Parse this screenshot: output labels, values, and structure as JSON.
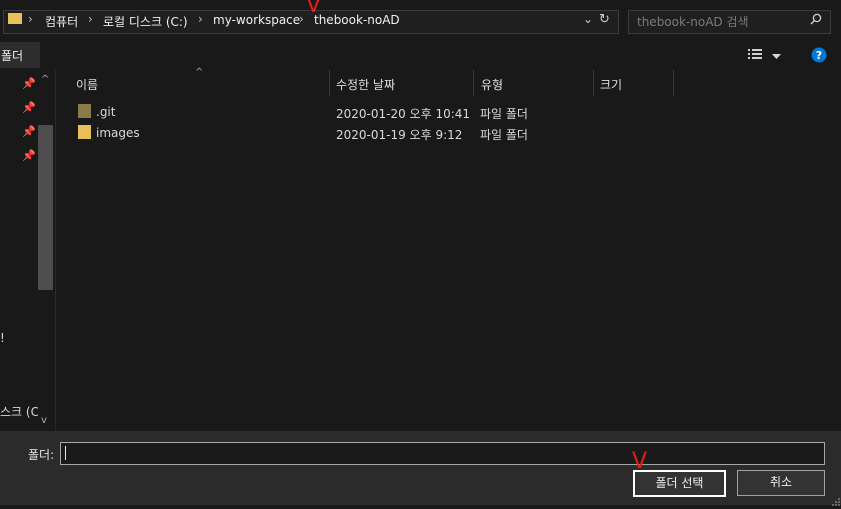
{
  "address_bar": {
    "crumbs": [
      "컴퓨터",
      "로컬 디스크 (C:)",
      "my-workspace",
      "thebook-noAD"
    ],
    "separator": "›",
    "dropdown_glyph": "⌄",
    "refresh_glyph": "↻"
  },
  "search": {
    "placeholder": "thebook-noAD 검색"
  },
  "toolbar": {
    "new_folder_label": "폴더"
  },
  "nav": {
    "pins": [
      "📌",
      "📌",
      "📌",
      "📌"
    ],
    "partial_drive_label": "스크 (C:)",
    "partial_exclamation": "!",
    "scroll_up": "^",
    "scroll_down": "v"
  },
  "columns": {
    "name": "이름",
    "modified": "수정한 날짜",
    "type": "유형",
    "size": "크기",
    "sort_glyph": "^"
  },
  "files": [
    {
      "name": ".git",
      "modified": "2020-01-20 오후 10:41",
      "type": "파일 폴더",
      "size": "",
      "hidden": true
    },
    {
      "name": "images",
      "modified": "2020-01-19 오후 9:12",
      "type": "파일 폴더",
      "size": "",
      "hidden": false
    }
  ],
  "bottom": {
    "folder_label": "폴더:",
    "folder_value": "",
    "select_button": "폴더 선택",
    "cancel_button": "취소"
  },
  "annotations": {
    "mark": "V"
  },
  "colors": {
    "accent": "#0078d7",
    "annotation_red": "#e0201c",
    "folder_yellow": "#e8c15a"
  }
}
